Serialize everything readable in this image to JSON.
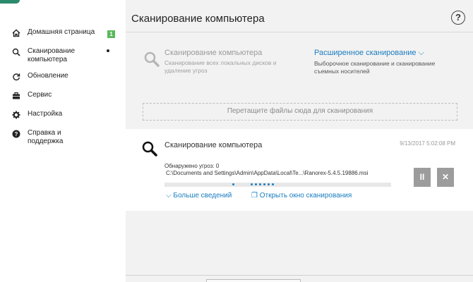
{
  "sidebar": {
    "items": [
      {
        "label": "Домашняя страница",
        "icon": "home-icon",
        "badge": "1"
      },
      {
        "label": "Сканирование компьютера",
        "icon": "search-icon"
      },
      {
        "label": "Обновление",
        "icon": "refresh-icon"
      },
      {
        "label": "Сервис",
        "icon": "briefcase-icon"
      },
      {
        "label": "Настройка",
        "icon": "gear-icon"
      },
      {
        "label": "Справка и поддержка",
        "icon": "help-icon"
      }
    ]
  },
  "header": {
    "title": "Сканирование компьютера",
    "help_label": "?"
  },
  "scan_options": {
    "computer_scan": {
      "title": "Сканирование компьютера",
      "description": "Сканирование всех локальных дисков и удаление угроз"
    },
    "advanced_scan": {
      "title": "Расширенное сканирование",
      "chevron": "⌵",
      "description": "Выборочное сканирование и сканирование съемных носителей"
    }
  },
  "drop_zone": {
    "label": "Перетащите файлы сюда для сканирования"
  },
  "scan_card": {
    "title": "Сканирование компьютера",
    "timestamp": "9/13/2017 5:02:08 PM",
    "threats": "Обнаружено угроз: 0",
    "current_file": "C:\\Documents and Settings\\Admin\\AppData\\Local\\Te...\\Ranorex-5.4.5.19886.msi",
    "more_info": "Больше сведений",
    "open_window": "Открыть окно сканирования",
    "pause_label": "II",
    "close_label": "✕"
  },
  "colors": {
    "accent": "#1a7dc0",
    "badge": "#5cb85c",
    "button_gray": "#9c9c9c"
  }
}
